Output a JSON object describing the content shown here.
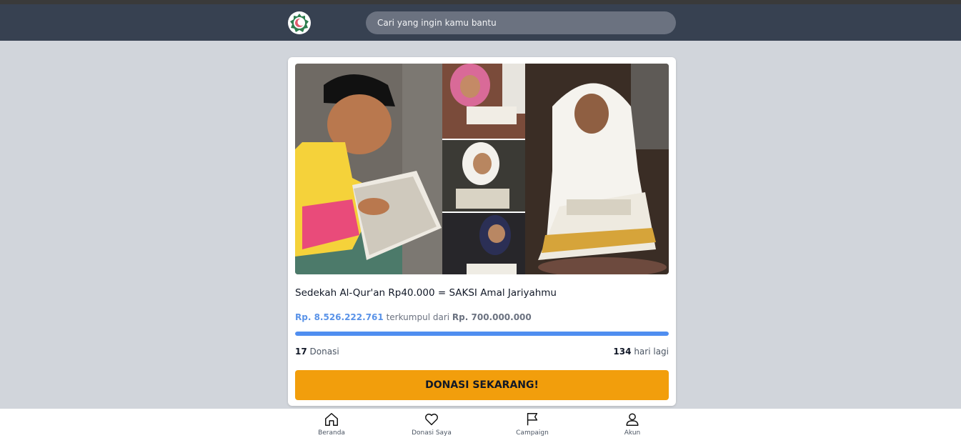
{
  "header": {
    "search_placeholder": "Cari yang ingin kamu bantu",
    "logo_icon": "crescent-logo-icon"
  },
  "campaign": {
    "image_icon": "children-reading-quran-photo",
    "title": "Sedekah Al-Qur'an Rp40.000 = SAKSI Amal Jariyahmu",
    "collected": "Rp. 8.526.222.761",
    "collected_connector": "terkumpul dari",
    "target": "Rp. 700.000.000",
    "progress_fraction": 1.0,
    "donation_count": "17",
    "donation_label": "Donasi",
    "days_left": "134",
    "days_left_label": "hari lagi",
    "donate_button": "DONASI SEKARANG!"
  },
  "bottom_nav": {
    "items": [
      {
        "label": "Beranda",
        "icon": "home-icon"
      },
      {
        "label": "Donasi Saya",
        "icon": "heart-icon"
      },
      {
        "label": "Campaign",
        "icon": "flag-icon"
      },
      {
        "label": "Akun",
        "icon": "user-icon"
      }
    ]
  },
  "colors": {
    "header_bg": "#374151",
    "page_bg": "#d1d5db",
    "accent_blue": "#4f8ef0",
    "donate_orange": "#f29e0c"
  }
}
